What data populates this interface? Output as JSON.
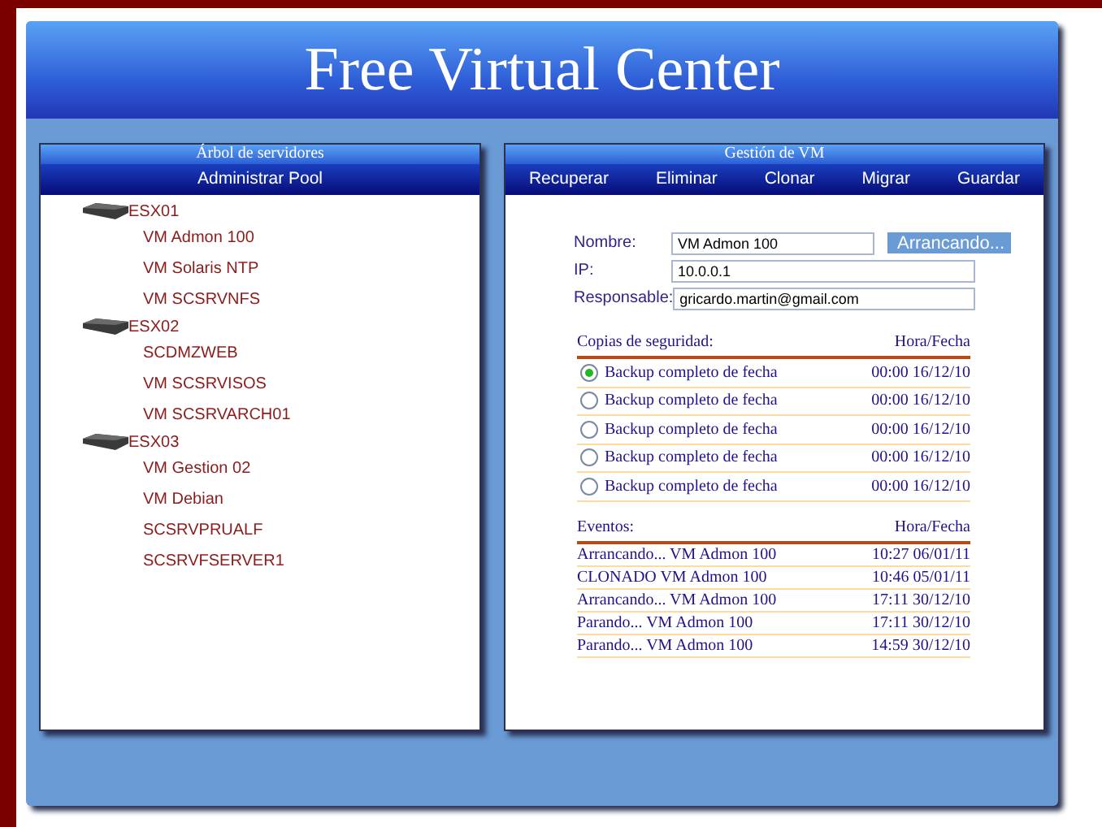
{
  "header": {
    "title": "Free Virtual Center"
  },
  "tree_panel": {
    "title": "Árbol de servidores",
    "menu": [
      "Administrar Pool"
    ],
    "servers": [
      {
        "name": "ESX01",
        "children": [
          {
            "name": "VM Admon 100"
          },
          {
            "name": "VM Solaris NTP"
          },
          {
            "name": "VM SCSRVNFS"
          }
        ]
      },
      {
        "name": "ESX02",
        "children": [
          {
            "name": "SCDMZWEB"
          },
          {
            "name": "VM SCSRVISOS"
          },
          {
            "name": "VM SCSRVARCH01"
          }
        ]
      },
      {
        "name": "ESX03",
        "children": [
          {
            "name": "VM Gestion 02"
          },
          {
            "name": "VM Debian"
          },
          {
            "name": "SCSRVPRUALF"
          },
          {
            "name": "SCSRVFSERVER1"
          }
        ]
      }
    ]
  },
  "vm_panel": {
    "title": "Gestión de VM",
    "menu": [
      "Recuperar",
      "Eliminar",
      "Clonar",
      "Migrar",
      "Guardar"
    ],
    "fields": [
      {
        "label": "Nombre:",
        "value": "VM Admon 100"
      },
      {
        "label": "IP:",
        "value": "10.0.0.1"
      },
      {
        "label": "Responsable:",
        "value": "gricardo.martin@gmail.com"
      }
    ],
    "status": "Arrancando...",
    "backups": {
      "columns": [
        "Copias de seguridad:",
        "Hora/Fecha"
      ],
      "rows": [
        {
          "name": "Backup completo de fecha",
          "time": "00:00 16/12/10",
          "selected": true
        },
        {
          "name": "Backup completo de fecha",
          "time": "00:00 16/12/10",
          "selected": false
        },
        {
          "name": "Backup completo de fecha",
          "time": "00:00 16/12/10",
          "selected": false
        },
        {
          "name": "Backup completo de fecha",
          "time": "00:00 16/12/10",
          "selected": false
        },
        {
          "name": "Backup completo de fecha",
          "time": "00:00 16/12/10",
          "selected": false
        }
      ]
    },
    "events": {
      "columns": [
        "Eventos:",
        "Hora/Fecha"
      ],
      "rows": [
        {
          "event": "Arrancando... VM Admon 100",
          "time": "10:27 06/01/11"
        },
        {
          "event": "CLONADO VM Admon 100",
          "time": "10:46 05/01/11"
        },
        {
          "event": "Arrancando... VM Admon 100",
          "time": "17:11 30/12/10"
        },
        {
          "event": "Parando... VM Admon 100",
          "time": "17:11 30/12/10"
        },
        {
          "event": "Parando... VM Admon 100",
          "time": "14:59 30/12/10"
        }
      ]
    }
  }
}
